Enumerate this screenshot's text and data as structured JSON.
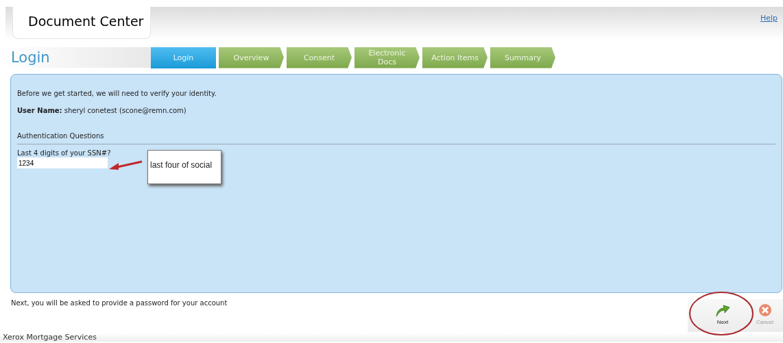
{
  "header": {
    "title": "Document Center",
    "help": "Help"
  },
  "page_title": "Login",
  "steps": [
    {
      "label": "Login",
      "selected": true
    },
    {
      "label": "Overview",
      "selected": false
    },
    {
      "label": "Consent",
      "selected": false
    },
    {
      "label": "Electronic Docs",
      "selected": false
    },
    {
      "label": "Action Items",
      "selected": false
    },
    {
      "label": "Summary",
      "selected": false
    }
  ],
  "panel": {
    "intro": "Before we get started, we will need to verify your identity.",
    "user_label": "User Name:",
    "user_value": "sheryl conetest (scone@remn.com)",
    "section": "Authentication Questions",
    "question": "Last 4 digits of your SSN#?",
    "answer": "1234"
  },
  "callout": {
    "text": "last four of social"
  },
  "note": "Next, you will be asked to provide a password for your account",
  "buttons": [
    {
      "label": "Next",
      "kind": "next",
      "disabled": false
    },
    {
      "label": "Cancel",
      "kind": "cancel",
      "disabled": true
    }
  ],
  "footer": "Xerox Mortgage Services"
}
